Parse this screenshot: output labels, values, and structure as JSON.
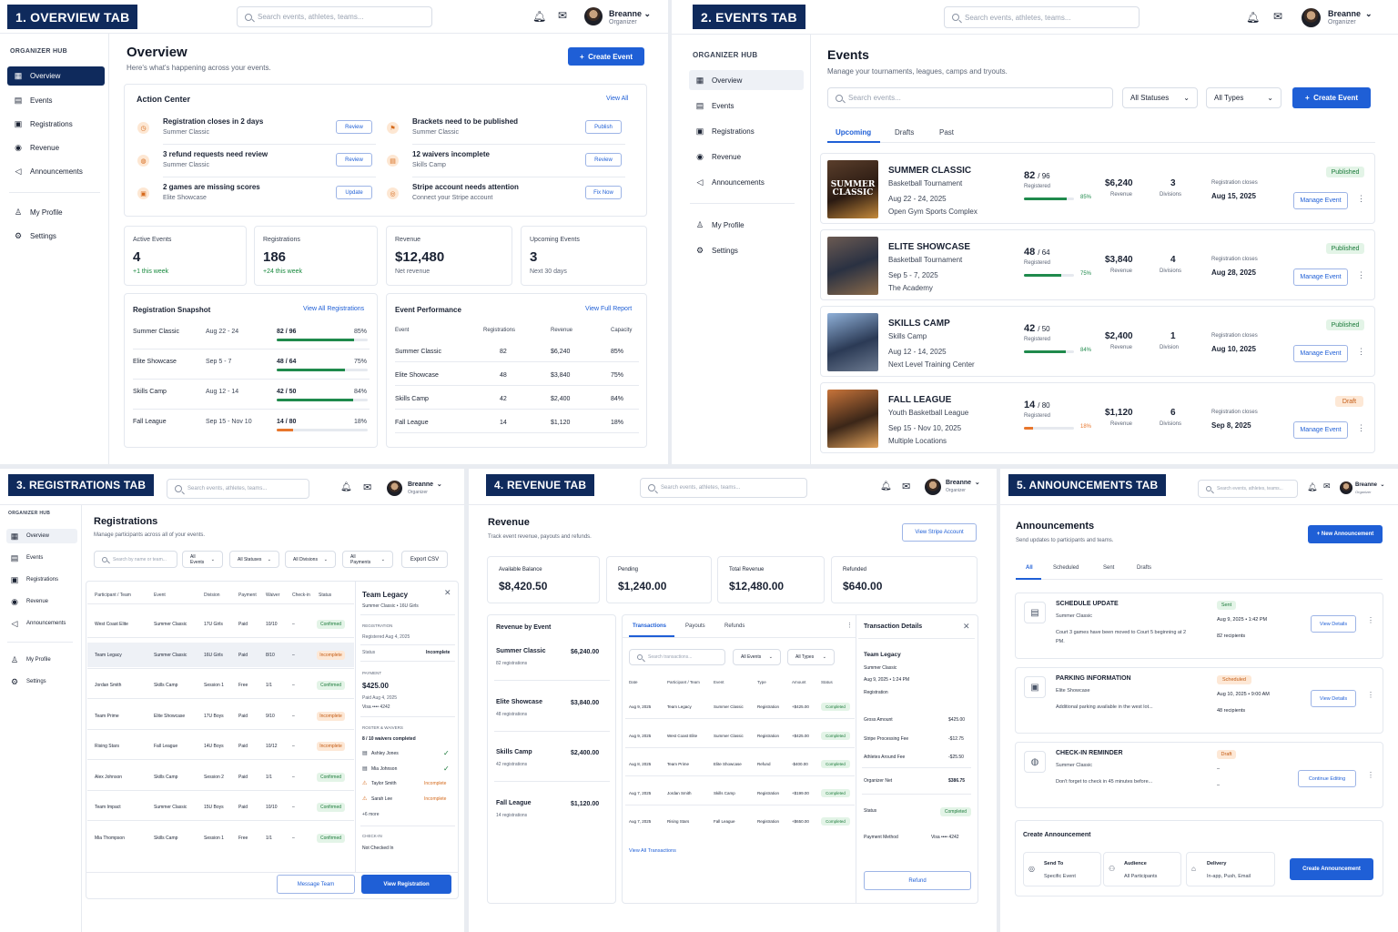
{
  "labels": {
    "p1": "1. OVERVIEW TAB",
    "p2": "2. EVENTS TAB",
    "p3": "3. REGISTRATIONS TAB",
    "p4": "4. REVENUE TAB",
    "p5": "5. ANNOUNCEMENTS TAB"
  },
  "global": {
    "search_placeholder": "Search events, athletes, teams...",
    "user_name": "Breanne",
    "user_role": "Organizer",
    "hub_title": "ORGANIZER HUB"
  },
  "nav": {
    "overview": "Overview",
    "events": "Events",
    "registrations": "Registrations",
    "revenue": "Revenue",
    "announcements": "Announcements",
    "profile": "My Profile",
    "settings": "Settings"
  },
  "overview": {
    "title": "Overview",
    "subtitle": "Here's what's happening across your events.",
    "create": "Create Event",
    "action_center": "Action Center",
    "view_all": "View All",
    "actions": [
      {
        "title": "Registration closes in 2 days",
        "sub": "Summer Classic",
        "btn": "Review"
      },
      {
        "title": "Brackets need to be published",
        "sub": "Summer Classic",
        "btn": "Publish"
      },
      {
        "title": "3 refund requests need review",
        "sub": "Summer Classic",
        "btn": "Review"
      },
      {
        "title": "12 waivers incomplete",
        "sub": "Skills Camp",
        "btn": "Review"
      },
      {
        "title": "2 games are missing scores",
        "sub": "Elite Showcase",
        "btn": "Update"
      },
      {
        "title": "Stripe account needs attention",
        "sub": "Connect your Stripe account",
        "btn": "Fix Now"
      }
    ],
    "stats": [
      {
        "label": "Active Events",
        "value": "4",
        "note": "+1 this week"
      },
      {
        "label": "Registrations",
        "value": "186",
        "note": "+24 this week"
      },
      {
        "label": "Revenue",
        "value": "$12,480",
        "note": "Net revenue"
      },
      {
        "label": "Upcoming Events",
        "value": "3",
        "note": "Next 30 days"
      }
    ],
    "snapshot": {
      "title": "Registration Snapshot",
      "link": "View All Registrations",
      "rows": [
        {
          "name": "Summer Classic",
          "dates": "Aug 22 - 24",
          "count": "82 / 96",
          "pct": "85%",
          "fill": 0.85
        },
        {
          "name": "Elite Showcase",
          "dates": "Sep 5 - 7",
          "count": "48 / 64",
          "pct": "75%",
          "fill": 0.75
        },
        {
          "name": "Skills Camp",
          "dates": "Aug 12 - 14",
          "count": "42 / 50",
          "pct": "84%",
          "fill": 0.84
        },
        {
          "name": "Fall League",
          "dates": "Sep 15 - Nov 10",
          "count": "14 / 80",
          "pct": "18%",
          "fill": 0.18
        }
      ]
    },
    "performance": {
      "title": "Event Performance",
      "link": "View Full Report",
      "headers": [
        "Event",
        "Registrations",
        "Revenue",
        "Capacity"
      ],
      "rows": [
        [
          "Summer Classic",
          "82",
          "$6,240",
          "85%"
        ],
        [
          "Elite Showcase",
          "48",
          "$3,840",
          "75%"
        ],
        [
          "Skills Camp",
          "42",
          "$2,400",
          "84%"
        ],
        [
          "Fall League",
          "14",
          "$1,120",
          "18%"
        ]
      ]
    }
  },
  "events": {
    "title": "Events",
    "subtitle": "Manage your tournaments, leagues, camps and tryouts.",
    "search": "Search events...",
    "status_filter": "All Statuses",
    "type_filter": "All Types",
    "create": "Create Event",
    "tabs": [
      "Upcoming",
      "Drafts",
      "Past"
    ],
    "reg_label": "Registered",
    "rev_label": "Revenue",
    "closes_label": "Registration closes",
    "manage": "Manage Event",
    "list": [
      {
        "name": "SUMMER CLASSIC",
        "type": "Basketball Tournament",
        "dates": "Aug 22 - 24, 2025",
        "venue": "Open Gym Sports Complex",
        "reg": "82",
        "cap": "/ 96",
        "pct": "85%",
        "fill": 0.85,
        "rev": "$6,240",
        "div": "3",
        "div_label": "Divisions",
        "closes": "Aug 15, 2025",
        "status": "Published",
        "img_text": "SUMMER CLASSIC"
      },
      {
        "name": "ELITE SHOWCASE",
        "type": "Basketball Tournament",
        "dates": "Sep 5 - 7, 2025",
        "venue": "The Academy",
        "reg": "48",
        "cap": "/ 64",
        "pct": "75%",
        "fill": 0.75,
        "rev": "$3,840",
        "div": "4",
        "div_label": "Divisions",
        "closes": "Aug 28, 2025",
        "status": "Published",
        "img_text": ""
      },
      {
        "name": "SKILLS CAMP",
        "type": "Skills Camp",
        "dates": "Aug 12 - 14, 2025",
        "venue": "Next Level Training Center",
        "reg": "42",
        "cap": "/ 50",
        "pct": "84%",
        "fill": 0.84,
        "rev": "$2,400",
        "div": "1",
        "div_label": "Division",
        "closes": "Aug 10, 2025",
        "status": "Published",
        "img_text": ""
      },
      {
        "name": "FALL LEAGUE",
        "type": "Youth Basketball League",
        "dates": "Sep 15 - Nov 10, 2025",
        "venue": "Multiple Locations",
        "reg": "14",
        "cap": "/ 80",
        "pct": "18%",
        "fill": 0.18,
        "rev": "$1,120",
        "div": "6",
        "div_label": "Divisions",
        "closes": "Sep 8, 2025",
        "status": "Draft",
        "img_text": ""
      }
    ]
  },
  "registrations": {
    "title": "Registrations",
    "subtitle": "Manage participants across all of your events.",
    "search": "Search by name or team...",
    "filters": [
      "All Events",
      "All Statuses",
      "All Divisions",
      "All Payments"
    ],
    "export": "Export CSV",
    "headers": [
      "Participant / Team",
      "Event",
      "Division",
      "Payment",
      "Waiver",
      "Check-in",
      "Status"
    ],
    "rows": [
      [
        "West Coast Elite",
        "Summer Classic",
        "17U Girls",
        "Paid",
        "10/10",
        "–",
        "Confirmed"
      ],
      [
        "Team Legacy",
        "Summer Classic",
        "16U Girls",
        "Paid",
        "8/10",
        "–",
        "Incomplete"
      ],
      [
        "Jordan Smith",
        "Skills Camp",
        "Session 1",
        "Free",
        "1/1",
        "–",
        "Confirmed"
      ],
      [
        "Team Prime",
        "Elite Showcase",
        "17U Boys",
        "Paid",
        "9/10",
        "–",
        "Incomplete"
      ],
      [
        "Rising Stars",
        "Fall League",
        "14U Boys",
        "Paid",
        "10/12",
        "–",
        "Incomplete"
      ],
      [
        "Alex Johnson",
        "Skills Camp",
        "Session 2",
        "Paid",
        "1/1",
        "–",
        "Confirmed"
      ],
      [
        "Team Impact",
        "Summer Classic",
        "15U Boys",
        "Paid",
        "10/10",
        "–",
        "Confirmed"
      ],
      [
        "Mia Thompson",
        "Skills Camp",
        "Session 1",
        "Free",
        "1/1",
        "–",
        "Confirmed"
      ]
    ],
    "detail": {
      "team": "Team Legacy",
      "sub": "Summer Classic • 16U Girls",
      "reg_label": "REGISTRATION",
      "reg_date": "Registered Aug 4, 2025",
      "status_label": "Status",
      "status": "Incomplete",
      "payment_label": "PAYMENT",
      "amount": "$425.00",
      "paid": "Paid Aug 4, 2025",
      "card": "Visa •••• 4242",
      "roster_label": "ROSTER & WAIVERS",
      "waivers": "8 / 10 waivers completed",
      "players": [
        {
          "name": "Ashley Jones",
          "state": "✓"
        },
        {
          "name": "Mia Johnson",
          "state": "✓"
        },
        {
          "name": "Taylor Smith",
          "state": "Incomplete"
        },
        {
          "name": "Sarah Lee",
          "state": "Incomplete"
        }
      ],
      "more": "+6 more",
      "checkin_label": "CHECK-IN",
      "checkin": "Not Checked In",
      "msg_btn": "Message Team",
      "view_btn": "View Registration"
    }
  },
  "revenue": {
    "title": "Revenue",
    "subtitle": "Track event revenue, payouts and refunds.",
    "stripe": "View Stripe Account",
    "stats": [
      {
        "label": "Available Balance",
        "value": "$8,420.50"
      },
      {
        "label": "Pending",
        "value": "$1,240.00"
      },
      {
        "label": "Total Revenue",
        "value": "$12,480.00"
      },
      {
        "label": "Refunded",
        "value": "$640.00"
      }
    ],
    "by_event_title": "Revenue by Event",
    "by_event": [
      {
        "name": "Summer Classic",
        "regs": "82 registrations",
        "amt": "$6,240.00"
      },
      {
        "name": "Elite Showcase",
        "regs": "48 registrations",
        "amt": "$3,840.00"
      },
      {
        "name": "Skills Camp",
        "regs": "42 registrations",
        "amt": "$2,400.00"
      },
      {
        "name": "Fall League",
        "regs": "14 registrations",
        "amt": "$1,120.00"
      }
    ],
    "tabs": [
      "Transactions",
      "Payouts",
      "Refunds"
    ],
    "search": "Search transactions...",
    "f1": "All Events",
    "f2": "All Types",
    "headers": [
      "Date",
      "Participant / Team",
      "Event",
      "Type",
      "Amount",
      "Status"
    ],
    "rows": [
      [
        "Aug 9, 2025",
        "Team Legacy",
        "Summer Classic",
        "Registration",
        "+$425.00",
        "Completed"
      ],
      [
        "Aug 9, 2025",
        "West Coast Elite",
        "Summer Classic",
        "Registration",
        "+$425.00",
        "Completed"
      ],
      [
        "Aug 8, 2025",
        "Team Prime",
        "Elite Showcase",
        "Refund",
        "-$400.00",
        "Completed"
      ],
      [
        "Aug 7, 2025",
        "Jordan Smith",
        "Skills Camp",
        "Registration",
        "+$199.00",
        "Completed"
      ],
      [
        "Aug 7, 2025",
        "Rising Stars",
        "Fall League",
        "Registration",
        "+$650.00",
        "Completed"
      ]
    ],
    "view_all": "View All Transactions",
    "detail": {
      "title": "Transaction Details",
      "team": "Team Legacy",
      "event": "Summer Classic",
      "date": "Aug 9, 2025 • 1:24 PM",
      "type": "Registration",
      "lines": [
        {
          "k": "Gross Amount",
          "v": "$425.00"
        },
        {
          "k": "Stripe Processing Fee",
          "v": "-$12.75"
        },
        {
          "k": "Athletes Around Fee",
          "v": "-$25.50"
        },
        {
          "k": "Organizer Net",
          "v": "$386.75"
        }
      ],
      "status_label": "Status",
      "status": "Completed",
      "pm_label": "Payment Method",
      "pm": "Visa •••• 4242",
      "refund": "Refund"
    }
  },
  "announcements": {
    "title": "Announcements",
    "subtitle": "Send updates to participants and teams.",
    "new": "+ New Announcement",
    "tabs": [
      "All",
      "Scheduled",
      "Sent",
      "Drafts"
    ],
    "items": [
      {
        "title": "SCHEDULE UPDATE",
        "event": "Summer Classic",
        "body": "Court 3 games have been moved to Court 5 beginning at 2 PM.",
        "status": "Sent",
        "when": "Aug 9, 2025 • 1:42 PM",
        "recip": "82 recipients",
        "btn": "View Details"
      },
      {
        "title": "PARKING INFORMATION",
        "event": "Elite Showcase",
        "body": "Additional parking available in the west lot...",
        "status": "Scheduled",
        "when": "Aug 10, 2025 • 9:00 AM",
        "recip": "48 recipients",
        "btn": "View Details"
      },
      {
        "title": "CHECK-IN REMINDER",
        "event": "Summer Classic",
        "body": "Don't forget to check in 45 minutes before...",
        "status": "Draft",
        "when": "–",
        "recip": "–",
        "btn": "Continue Editing"
      }
    ],
    "create_title": "Create Announcement",
    "opts": [
      {
        "k": "Send To",
        "v": "Specific Event"
      },
      {
        "k": "Audience",
        "v": "All Participants"
      },
      {
        "k": "Delivery",
        "v": "In-app, Push, Email"
      }
    ],
    "create_btn": "Create Announcement"
  },
  "colors": {
    "navy": "#0f2a5c",
    "blue": "#1f5fd6",
    "green": "#1f8a4c",
    "orange": "#e8762c"
  }
}
